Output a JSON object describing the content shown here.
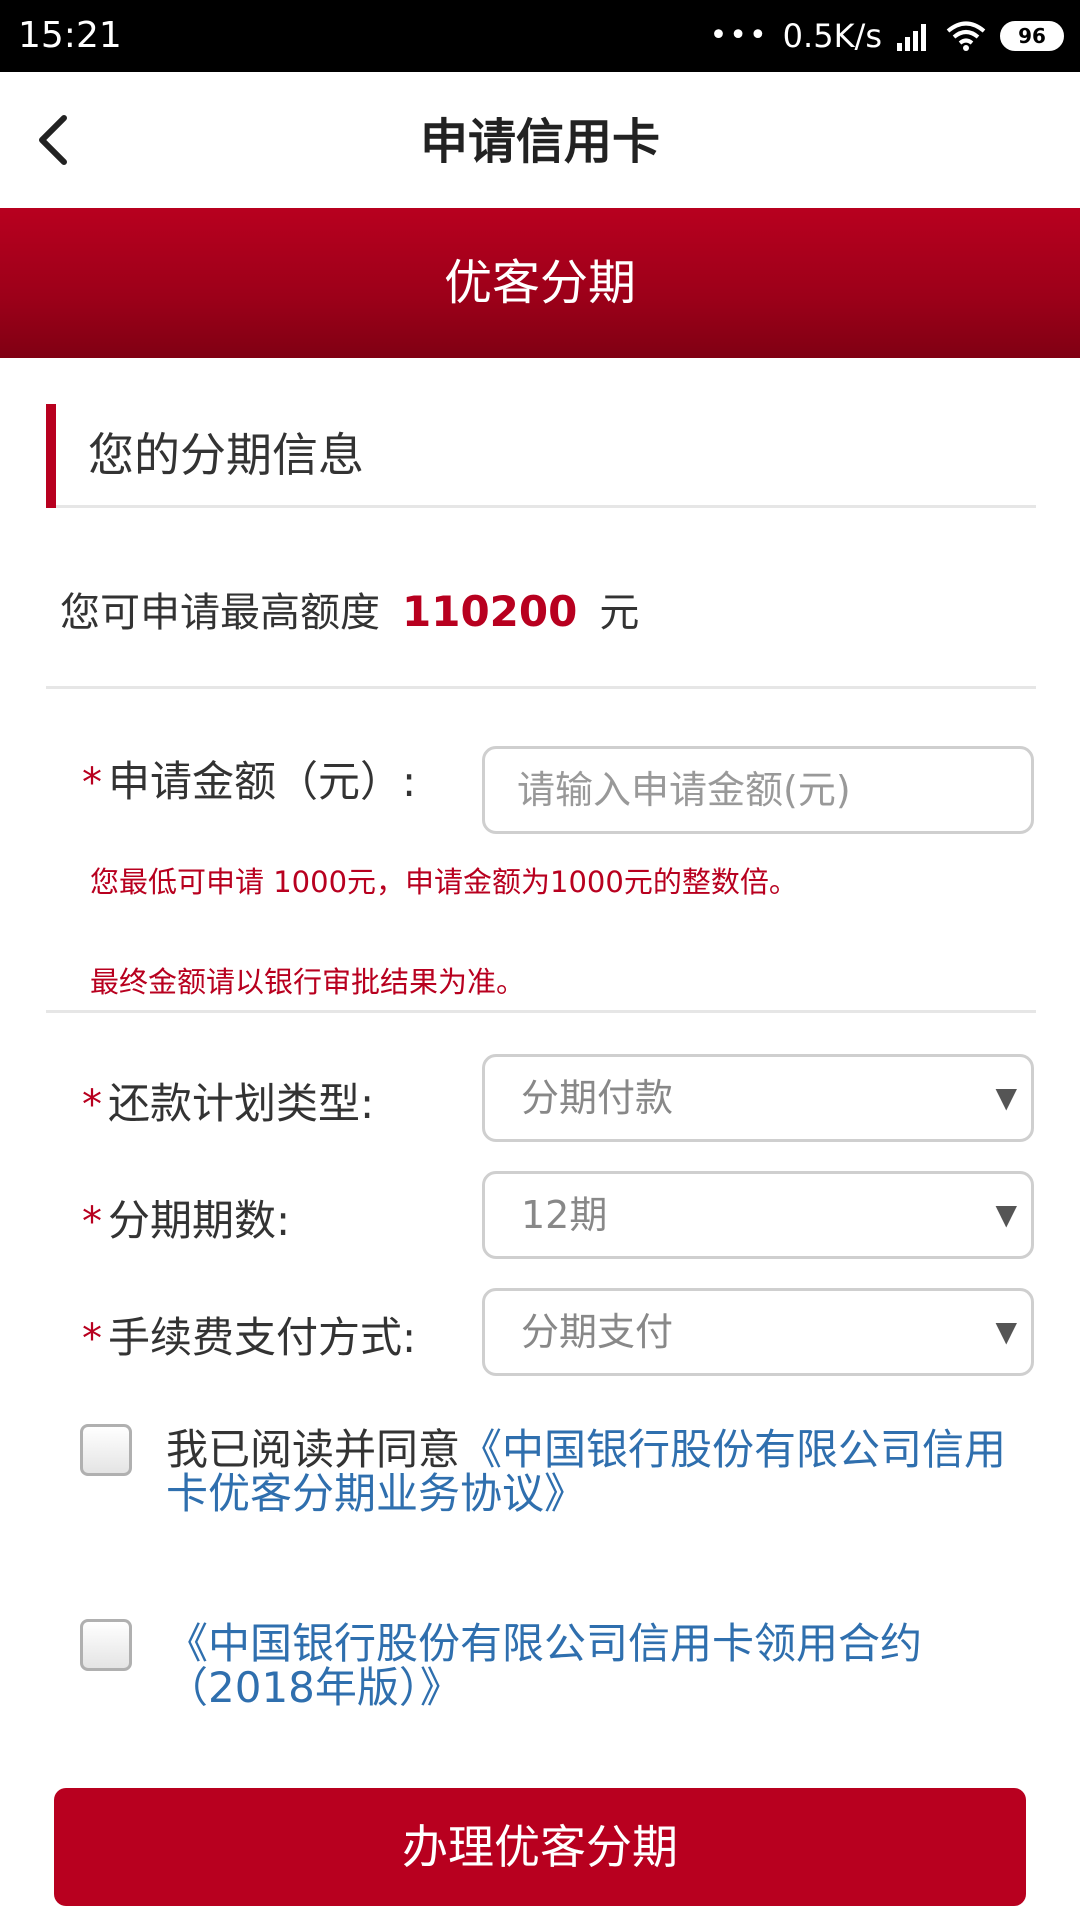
{
  "status_bar": {
    "time": "15:21",
    "dots": "•••",
    "network_speed": "0.5K/s",
    "battery": "96",
    "icons": [
      "signal-icon",
      "wifi-icon",
      "battery-icon"
    ]
  },
  "nav": {
    "title": "申请信用卡",
    "back_icon": "chevron-left-icon"
  },
  "banner": {
    "title": "优客分期"
  },
  "section": {
    "title": "您的分期信息"
  },
  "limit": {
    "label": "您可申请最高额度",
    "value": "110200",
    "unit": "元"
  },
  "form": {
    "required_mark": "*",
    "amount": {
      "label": "申请金额（元）:",
      "placeholder": "请输入申请金额(元)"
    },
    "hint_min": "您最低可申请 1000元，申请金额为1000元的整数倍。",
    "hint_final": "最终金额请以银行审批结果为准。",
    "repay_type": {
      "label": "还款计划类型:",
      "value": "分期付款"
    },
    "periods": {
      "label": "分期期数:",
      "value": "12期"
    },
    "fee_method": {
      "label": "手续费支付方式:",
      "value": "分期支付"
    },
    "select_arrow": "▼"
  },
  "agreements": {
    "agree_prefix": "我已阅读并同意",
    "agreement1_link": "《中国银行股份有限公司信用卡优客分期业务协议》",
    "agreement2_link": "《中国银行股份有限公司信用卡领用合约（2018年版）》"
  },
  "submit": {
    "label": "办理优客分期"
  },
  "colors": {
    "brand_red": "#b8001f",
    "link_blue": "#2f6fae"
  }
}
